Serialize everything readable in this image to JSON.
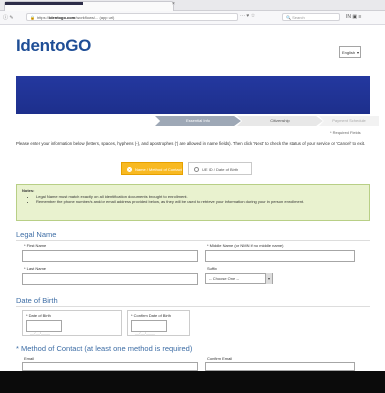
{
  "browser": {
    "url_prefix": "https://",
    "url_domain": "identogo.com",
    "url_path": "/workflows/... (app url)",
    "search_placeholder": "Search",
    "page_actions": "··· ♥ ☆",
    "right_icons": "IN ▣ ≡",
    "nav_icons": "ⓘ ✎"
  },
  "brand": {
    "logo_text": "IdentoGO",
    "language": "English"
  },
  "steps": [
    "Essential Info",
    "Citizenship",
    "Payment Schedule"
  ],
  "required_note": "* Required Fields",
  "instructions": "Please enter your information below (letters, spaces, hyphens (-), and apostrophes (') are allowed in name fields). Then click 'Next' to check the status of your service or 'Cancel' to exit.",
  "toggle": {
    "option1": "Name / Method of Contact",
    "option2": "UE ID / Date of Birth"
  },
  "notes": {
    "title": "Notes:",
    "items": [
      "Legal Name must match exactly on all identification documents brought to enrollment.",
      "Remember the phone number/s and/or email address provided below, as they will be used to retrieve your information during your in person enrollment."
    ]
  },
  "legal_name": {
    "heading": "Legal Name",
    "first_name_label": "* First Name",
    "middle_name_label": "* Middle Name (or NMN if no middle name)",
    "last_name_label": "* Last Name",
    "suffix_label": "Suffix",
    "suffix_value": "-- Choose One --"
  },
  "dob": {
    "heading": "Date of Birth",
    "dob_label": "* Date of Birth",
    "confirm_label": "* Confirm Date of Birth",
    "placeholder": "__/__/____"
  },
  "contact": {
    "heading": "* Method of Contact (at least one method is required)",
    "email_label": "Email",
    "confirm_email_label": "Confirm Email"
  },
  "colors": {
    "logo": "#1f4e96",
    "banner": "#24389f",
    "active_toggle": "#f8b922",
    "notes_bg": "#e9f2cf",
    "section_heading": "#3d6da5"
  }
}
